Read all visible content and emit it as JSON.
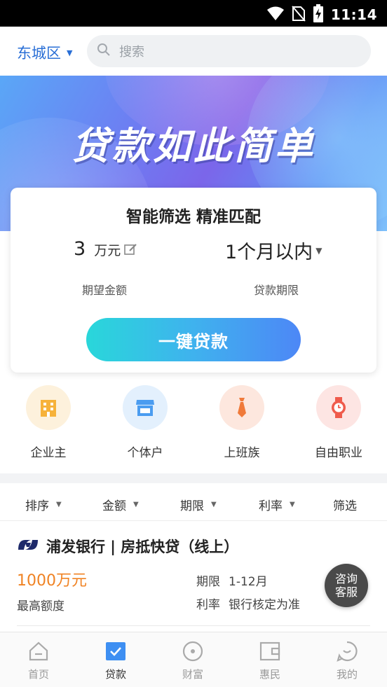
{
  "status_bar": {
    "time": "11:14"
  },
  "header": {
    "city": "东城区",
    "search_placeholder": "搜索"
  },
  "banner": {
    "title": "贷款如此简单"
  },
  "match_card": {
    "title": "智能筛选 精准匹配",
    "amount_value": "3",
    "amount_unit": "万元",
    "amount_label": "期望金额",
    "term_value": "1个月以内",
    "term_label": "贷款期限",
    "button_label": "一键贷款"
  },
  "categories": [
    {
      "label": "企业主",
      "icon": "building-icon",
      "bg": "#fdf1dc",
      "color": "#f6b23a"
    },
    {
      "label": "个体户",
      "icon": "shop-icon",
      "bg": "#e3f0fd",
      "color": "#4a9cf0"
    },
    {
      "label": "上班族",
      "icon": "tie-icon",
      "bg": "#fde7de",
      "color": "#f07a3a"
    },
    {
      "label": "自由职业",
      "icon": "watch-icon",
      "bg": "#fde5e3",
      "color": "#ef5b4c"
    }
  ],
  "filters": [
    {
      "label": "排序"
    },
    {
      "label": "金额"
    },
    {
      "label": "期限"
    },
    {
      "label": "利率"
    },
    {
      "label": "筛选"
    }
  ],
  "product": {
    "title": "浦发银行 | 房抵快贷（线上）",
    "amount": "1000万元",
    "amount_label": "最高额度",
    "term_key": "期限",
    "term_value": "1-12月",
    "rate_key": "利率",
    "rate_value": "银行核定为准",
    "consult_line1": "咨询",
    "consult_line2": "客服"
  },
  "bottom_nav": [
    {
      "label": "首页",
      "icon": "home-icon",
      "active": false
    },
    {
      "label": "贷款",
      "icon": "loan-check-icon",
      "active": true
    },
    {
      "label": "财富",
      "icon": "wealth-icon",
      "active": false
    },
    {
      "label": "惠民",
      "icon": "wallet-icon",
      "active": false
    },
    {
      "label": "我的",
      "icon": "profile-icon",
      "active": false
    }
  ],
  "colors": {
    "accent": "#2a6fd6",
    "amount_orange": "#f08324",
    "button_start": "#29d7da",
    "button_end": "#4d87f6"
  }
}
